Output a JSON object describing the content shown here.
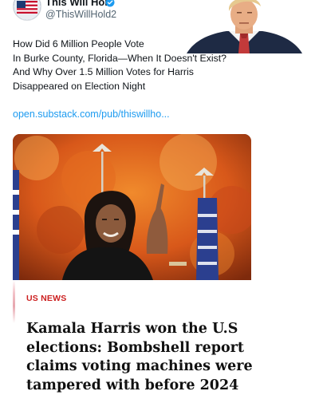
{
  "tweet": {
    "display_name": "This Will Hold",
    "handle": "@ThisWillHold2",
    "verified_icon": "verified-badge-icon",
    "text_lines": [
      "How Did 6 Million People Vote",
      "In Burke County, Florida—When It Doesn't Exist?",
      "And Why Over 1.5 Million Votes for Harris",
      "Disappeared on Election Night"
    ],
    "link": "open.substack.com/pub/thiswillho..."
  },
  "card": {
    "category": "US NEWS",
    "headline_lines": [
      "Kamala Harris won the U.S",
      "elections: Bombshell report",
      "claims voting machines were",
      "tampered with before 2024"
    ]
  },
  "colors": {
    "link": "#1d9bf0",
    "category": "#cc1f1f",
    "verified": "#1d9bf0"
  }
}
